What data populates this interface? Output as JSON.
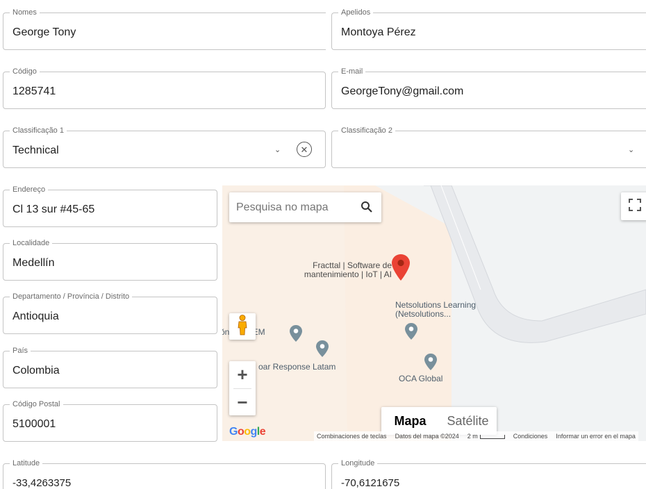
{
  "form": {
    "nomes": {
      "label": "Nomes",
      "value": "George Tony"
    },
    "apelidos": {
      "label": "Apelidos",
      "value": "Montoya Pérez"
    },
    "codigo": {
      "label": "Código",
      "value": "1285741"
    },
    "email": {
      "label": "E-mail",
      "value": "GeorgeTony@gmail.com"
    },
    "classificacao1": {
      "label": "Classificação 1",
      "value": "Technical"
    },
    "classificacao2": {
      "label": "Classificação 2",
      "value": ""
    },
    "endereco": {
      "label": "Endereço",
      "value": "Cl 13 sur #45-65"
    },
    "localidade": {
      "label": "Localidade",
      "value": "Medellín"
    },
    "departamento": {
      "label": "Departamento / Província / Distrito",
      "value": "Antioquia"
    },
    "pais": {
      "label": "País",
      "value": "Colombia"
    },
    "codigo_postal": {
      "label": "Código Postal",
      "value": "5100001"
    },
    "latitude": {
      "label": "Latitude",
      "value": "-33,4263375"
    },
    "longitude": {
      "label": "Longitude",
      "value": "-70,6121675"
    }
  },
  "map": {
    "search_placeholder": "Pesquisa no mapa",
    "places": {
      "fracttal_line1": "Fracttal | Software de",
      "fracttal_line2": "mantenimiento | IoT | AI",
      "netsolutions_line1": "Netsolutions Learning",
      "netsolutions_line2": "(Netsolutions...",
      "niquem": "ŏn NIQUEM",
      "response": "oar Response Latam",
      "oca": "OCA Global"
    },
    "map_type": {
      "mapa": "Mapa",
      "satelite": "Satélite"
    },
    "zoom_in": "+",
    "zoom_out": "−",
    "attribution": {
      "shortcuts": "Combinaciones de teclas",
      "data": "Datos del mapa ©2024",
      "scale": "2 m",
      "terms": "Condiciones",
      "report": "Informar un error en el mapa"
    },
    "icons": [
      "search-icon",
      "fullscreen-icon",
      "pegman-icon",
      "red-pin-icon",
      "poi-pin-icon"
    ],
    "colors": {
      "pin_red": "#ea4335",
      "poi_gray": "#78909c",
      "label_blue": "#4d5d6b"
    }
  }
}
